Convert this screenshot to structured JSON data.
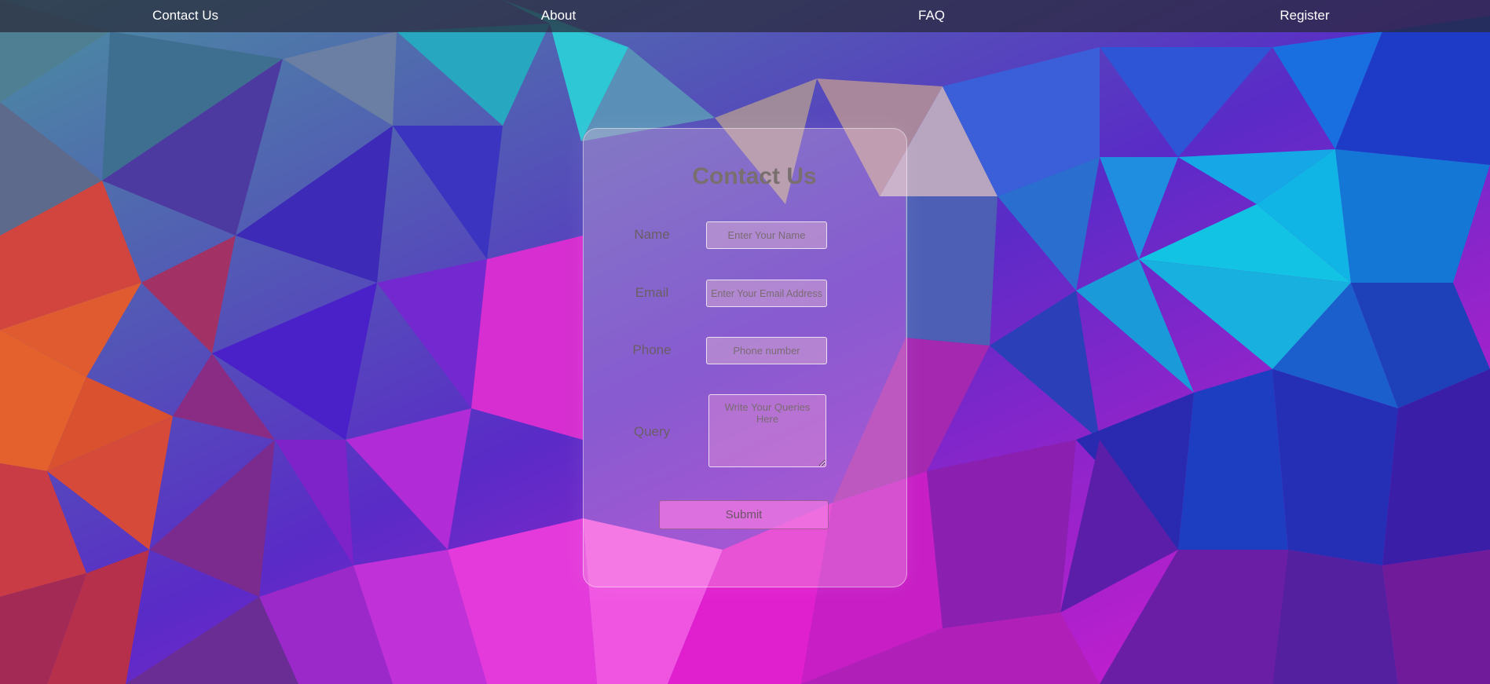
{
  "nav": {
    "items": [
      {
        "label": "Contact Us"
      },
      {
        "label": "About"
      },
      {
        "label": "FAQ"
      },
      {
        "label": "Register"
      }
    ]
  },
  "form": {
    "title": "Contact Us",
    "name_label": "Name",
    "name_placeholder": "Enter Your Name",
    "name_value": "",
    "email_label": "Email",
    "email_placeholder": "Enter Your Email Address",
    "email_value": "",
    "phone_label": "Phone",
    "phone_placeholder": "Phone number",
    "phone_value": "",
    "query_label": "Query",
    "query_placeholder": "Write Your Queries Here",
    "query_value": "",
    "submit_label": "Submit"
  },
  "colors": {
    "navbar": "#2c2a3a",
    "card_title": "#7a6f6f",
    "submit_button": "#f078e1",
    "nav_text": "#ffffff"
  }
}
